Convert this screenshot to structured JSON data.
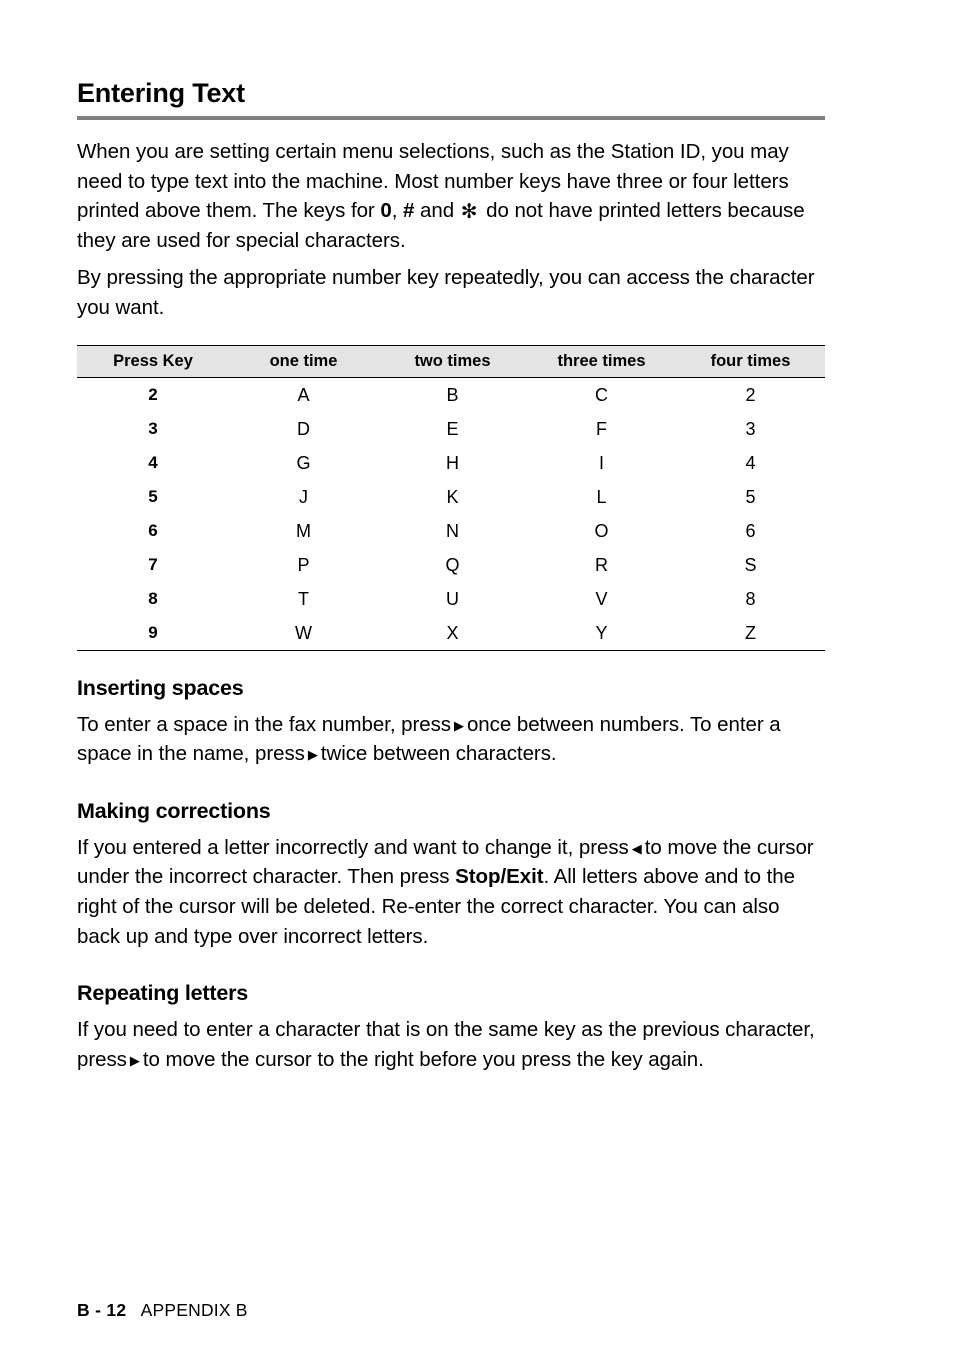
{
  "document": {
    "title": "Entering Text",
    "intro_paragraphs": {
      "p1_part1": "When you are setting certain menu selections, such as the Station ID, you may need to type text into the machine. Most number keys have three or four letters printed above them. The keys for ",
      "p1_bold_zero": "0",
      "p1_part2": ", ",
      "p1_bold_hash": "#",
      "p1_part3": " and ",
      "p1_star_glyph": "✻",
      "p1_part4": " do not have printed letters because they are used for special characters.",
      "p2": "By pressing the appropriate number key repeatedly, you can access the character you want."
    },
    "table": {
      "headers": [
        "Press Key",
        "one time",
        "two times",
        "three times",
        "four times"
      ],
      "rows": [
        {
          "key": "2",
          "one": "A",
          "two": "B",
          "three": "C",
          "four": "2"
        },
        {
          "key": "3",
          "one": "D",
          "two": "E",
          "three": "F",
          "four": "3"
        },
        {
          "key": "4",
          "one": "G",
          "two": "H",
          "three": "I",
          "four": "4"
        },
        {
          "key": "5",
          "one": "J",
          "two": "K",
          "three": "L",
          "four": "5"
        },
        {
          "key": "6",
          "one": "M",
          "two": "N",
          "three": "O",
          "four": "6"
        },
        {
          "key": "7",
          "one": "P",
          "two": "Q",
          "three": "R",
          "four": "S"
        },
        {
          "key": "8",
          "one": "T",
          "two": "U",
          "three": "V",
          "four": "8"
        },
        {
          "key": "9",
          "one": "W",
          "two": "X",
          "three": "Y",
          "four": "Z"
        }
      ]
    },
    "sections": {
      "inserting_spaces": {
        "heading": "Inserting spaces",
        "text_part1": "To enter a space in the fax number, press",
        "arrow1": "▶",
        "text_part2": "once between numbers. To enter a space in the name, press",
        "arrow2": "▶",
        "text_part3": "twice between characters."
      },
      "making_corrections": {
        "heading": "Making corrections",
        "text_part1": "If you entered a letter incorrectly and want to change it, press",
        "arrow1": "◀",
        "text_part2": "to move the cursor under the incorrect character. Then press ",
        "bold_key": "Stop/Exit",
        "text_part3": ". All letters above and to the right of the cursor will be deleted. Re-enter the correct character. You can also back up and type over incorrect letters."
      },
      "repeating_letters": {
        "heading": "Repeating letters",
        "text_part1": "If you need to enter a character that is on the same key as the previous character, press",
        "arrow1": "▶",
        "text_part2": "to move the cursor to the right before you press the key again."
      }
    },
    "footer": {
      "page_number": "B - 12",
      "section_label": "APPENDIX B"
    },
    "colors": {
      "title_rule": "#808080",
      "table_header_bg": "#e4e4e4",
      "text": "#000000",
      "page_bg": "#ffffff"
    }
  }
}
